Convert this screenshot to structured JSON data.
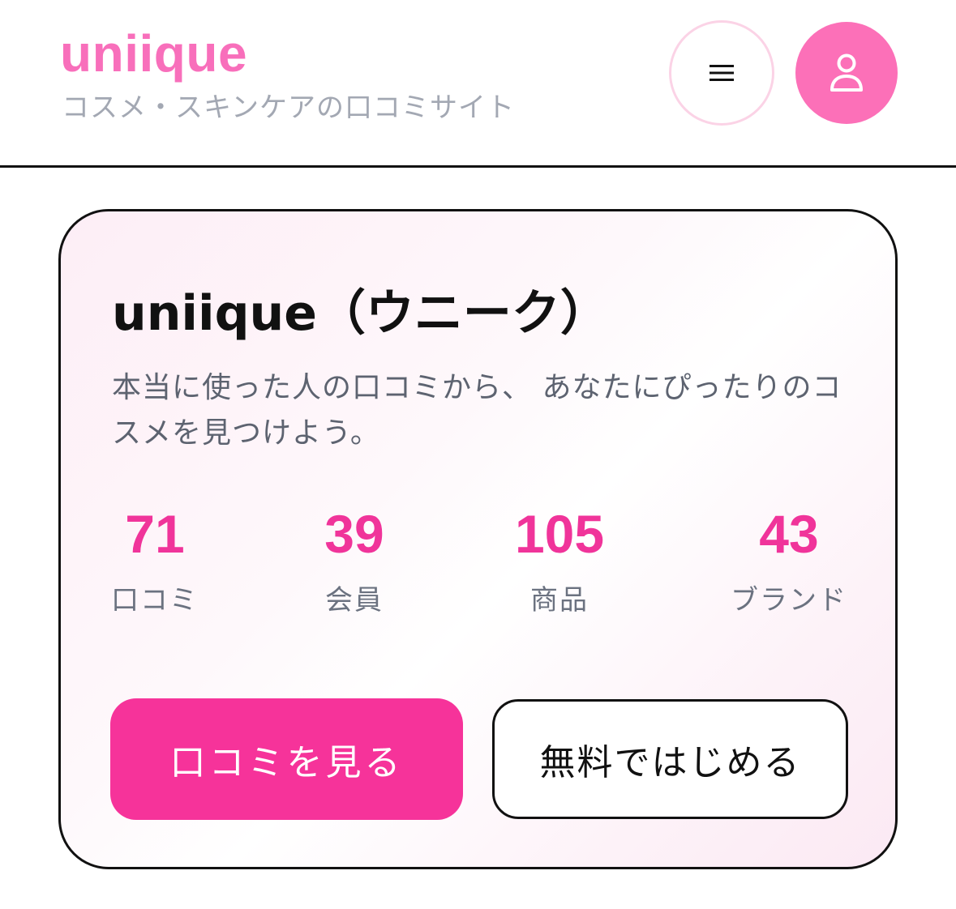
{
  "header": {
    "logo": "uniique",
    "tagline": "コスメ・スキンケアの口コミサイト",
    "menu_icon": "menu-icon",
    "user_icon": "user-icon"
  },
  "hero": {
    "title": "uniique（ウニーク）",
    "description": "本当に使った人の口コミから、 あなたにぴったりのコスメを見つけよう。",
    "stats": [
      {
        "value": "71",
        "label": "口コミ"
      },
      {
        "value": "39",
        "label": "会員"
      },
      {
        "value": "105",
        "label": "商品"
      },
      {
        "value": "43",
        "label": "ブランド"
      }
    ],
    "primary_button": "口コミを見る",
    "secondary_button": "無料ではじめる"
  },
  "colors": {
    "brand_pink": "#f86fbb",
    "accent": "#f6339a",
    "muted_text": "#a3a8b3"
  }
}
